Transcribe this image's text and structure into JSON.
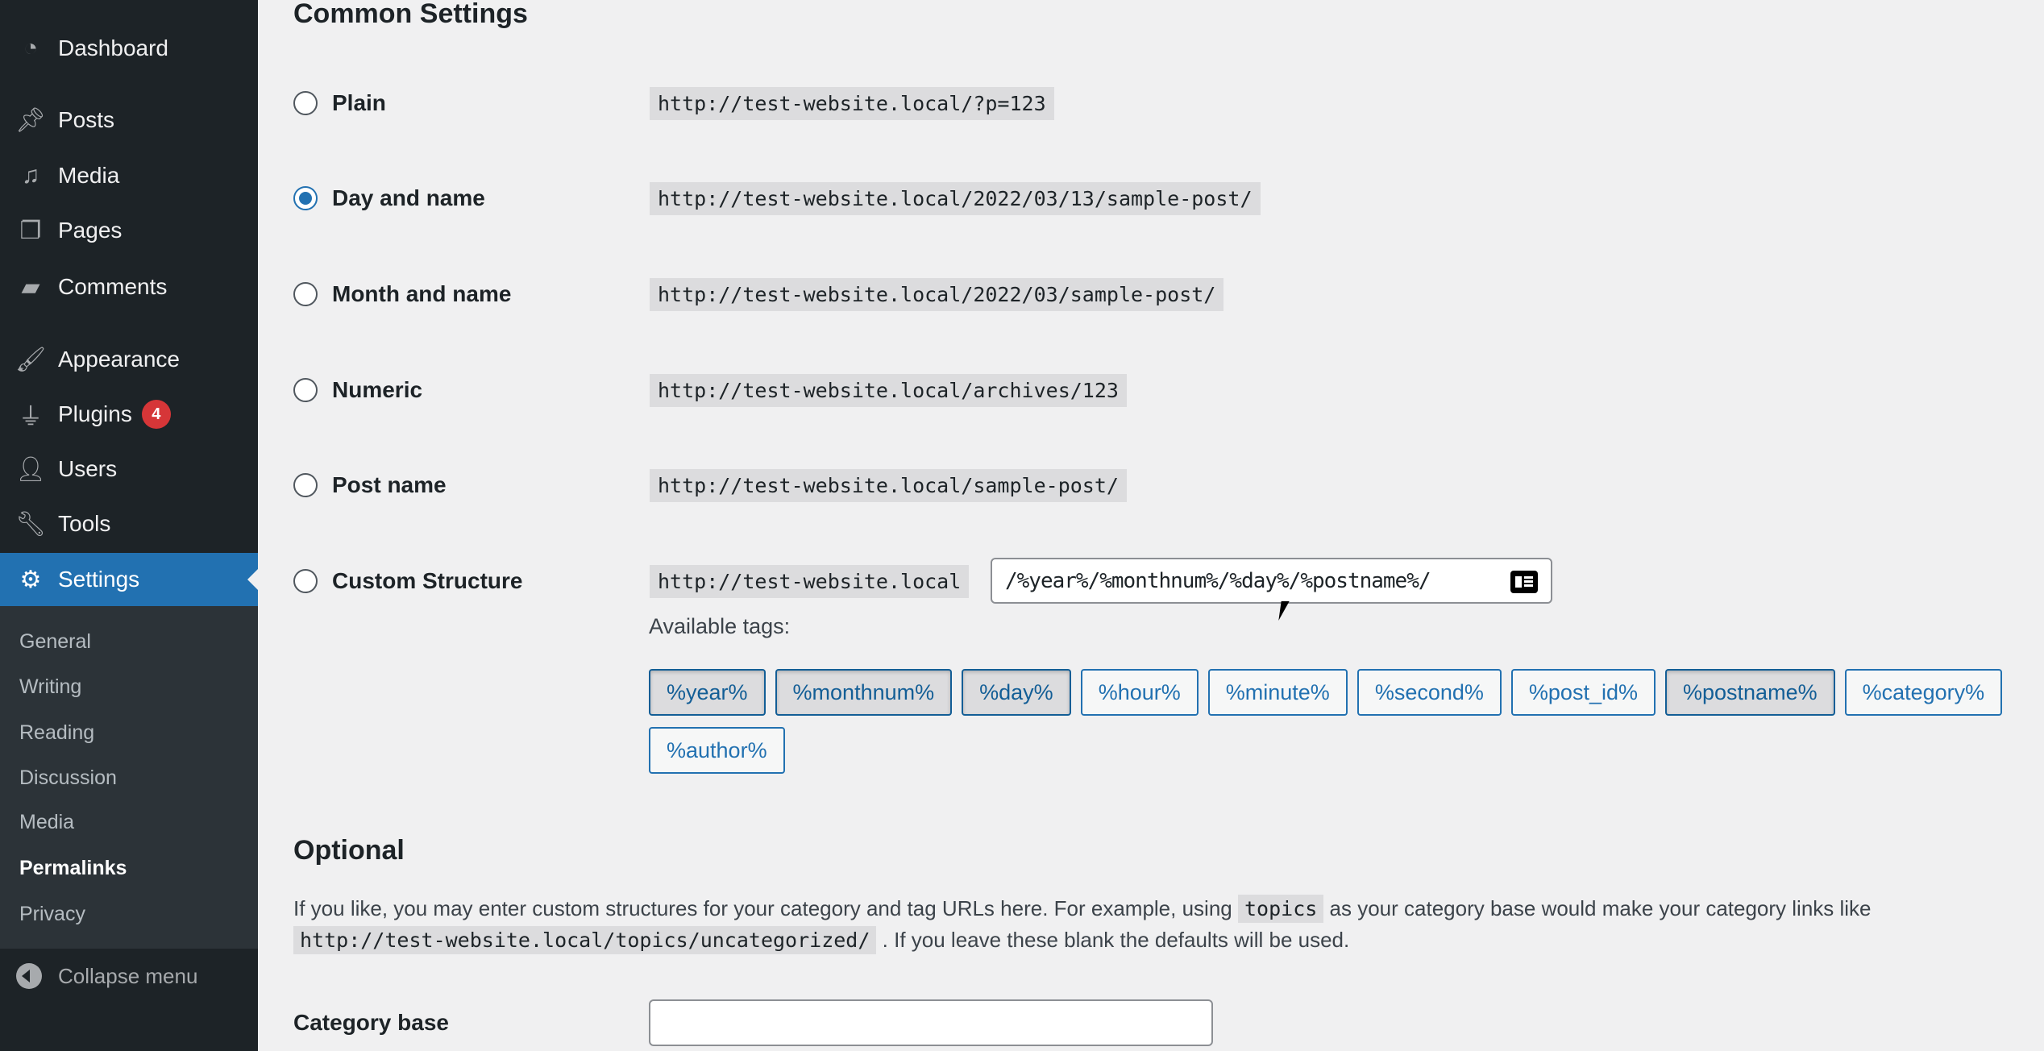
{
  "sidebar": {
    "items": [
      {
        "label": "Dashboard",
        "icon": "dashboard-icon"
      },
      {
        "label": "Posts",
        "icon": "pin-icon"
      },
      {
        "label": "Media",
        "icon": "media-icon"
      },
      {
        "label": "Pages",
        "icon": "pages-icon"
      },
      {
        "label": "Comments",
        "icon": "comment-icon"
      },
      {
        "label": "Appearance",
        "icon": "brush-icon"
      },
      {
        "label": "Plugins",
        "icon": "plugin-icon",
        "badge": "4"
      },
      {
        "label": "Users",
        "icon": "user-icon"
      },
      {
        "label": "Tools",
        "icon": "wrench-icon"
      },
      {
        "label": "Settings",
        "icon": "settings-icon",
        "active": true
      }
    ],
    "submenu": [
      "General",
      "Writing",
      "Reading",
      "Discussion",
      "Media",
      "Permalinks",
      "Privacy"
    ],
    "current_sub": "Permalinks",
    "collapse": "Collapse menu"
  },
  "main": {
    "common_heading": "Common Settings",
    "options": [
      {
        "label": "Plain",
        "url": "http://test-website.local/?p=123",
        "checked": false
      },
      {
        "label": "Day and name",
        "url": "http://test-website.local/2022/03/13/sample-post/",
        "checked": true
      },
      {
        "label": "Month and name",
        "url": "http://test-website.local/2022/03/sample-post/",
        "checked": false
      },
      {
        "label": "Numeric",
        "url": "http://test-website.local/archives/123",
        "checked": false
      },
      {
        "label": "Post name",
        "url": "http://test-website.local/sample-post/",
        "checked": false
      },
      {
        "label": "Custom Structure",
        "url": "http://test-website.local",
        "checked": false
      }
    ],
    "custom_value": "/%year%/%monthnum%/%day%/%postname%/",
    "available_tags_label": "Available tags:",
    "tags": [
      {
        "label": "%year%",
        "used": true
      },
      {
        "label": "%monthnum%",
        "used": true
      },
      {
        "label": "%day%",
        "used": true
      },
      {
        "label": "%hour%",
        "used": false
      },
      {
        "label": "%minute%",
        "used": false
      },
      {
        "label": "%second%",
        "used": false
      },
      {
        "label": "%post_id%",
        "used": false
      },
      {
        "label": "%postname%",
        "used": true
      },
      {
        "label": "%category%",
        "used": false
      },
      {
        "label": "%author%",
        "used": false
      }
    ],
    "optional_heading": "Optional",
    "desc_1": "If you like, you may enter custom structures for your category and tag URLs here. For example, using",
    "desc_code1": "topics",
    "desc_2": "as your category base would make your category links like",
    "desc_code2": "http://test-website.local/topics/uncategorized/",
    "desc_3": ". If you leave these blank the defaults will be used.",
    "category_base_label": "Category base",
    "category_base_value": ""
  }
}
